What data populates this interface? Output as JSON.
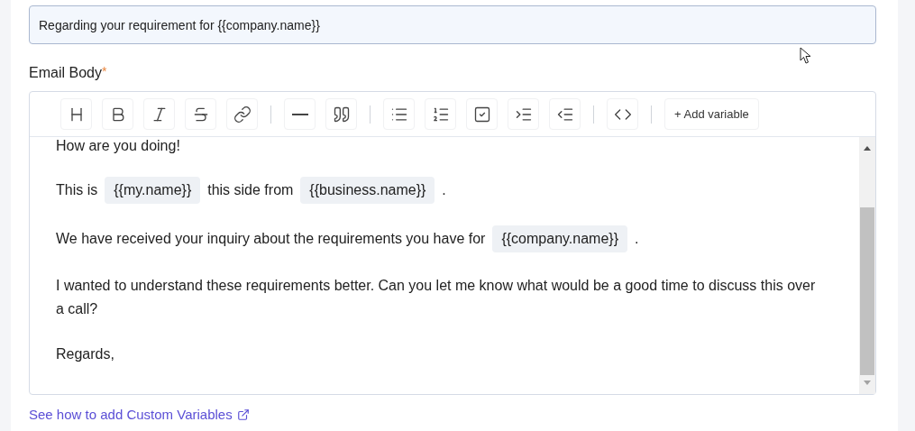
{
  "subject_field": {
    "value": "Regarding your requirement for {{company.name}}"
  },
  "email_body": {
    "label": "Email Body",
    "required_mark": "*",
    "toolbar": [
      [
        {
          "kind": "heading"
        },
        {
          "kind": "bold"
        },
        {
          "kind": "italic"
        },
        {
          "kind": "strikethrough"
        },
        {
          "kind": "link"
        }
      ],
      [
        {
          "kind": "divider"
        },
        {
          "kind": "quote"
        }
      ],
      [
        {
          "kind": "bullet_list"
        },
        {
          "kind": "ordered_list"
        },
        {
          "kind": "task_list"
        },
        {
          "kind": "indent"
        },
        {
          "kind": "outdent"
        }
      ],
      [
        {
          "kind": "code"
        }
      ]
    ],
    "add_variable_button": "+ Add variable",
    "paragraphs": [
      [
        {
          "kind": "text",
          "text": "How are you doing!"
        }
      ],
      [
        {
          "kind": "text",
          "text": "This is"
        },
        {
          "kind": "variable",
          "text": "{{my.name}}"
        },
        {
          "kind": "text",
          "text": "this side from"
        },
        {
          "kind": "variable",
          "text": "{{business.name}}"
        },
        {
          "kind": "text",
          "text": "."
        }
      ],
      [
        {
          "kind": "text",
          "text": "We have received your inquiry about the requirements you have for"
        },
        {
          "kind": "variable",
          "text": "{{company.name}}"
        },
        {
          "kind": "text",
          "text": "."
        }
      ],
      [
        {
          "kind": "text",
          "text": "I wanted to understand these requirements better. Can you let me know what would be a good time to discuss this over a call?"
        }
      ],
      [
        {
          "kind": "text",
          "text": "Regards,"
        }
      ]
    ]
  },
  "help_link": "See how to add Custom Variables"
}
